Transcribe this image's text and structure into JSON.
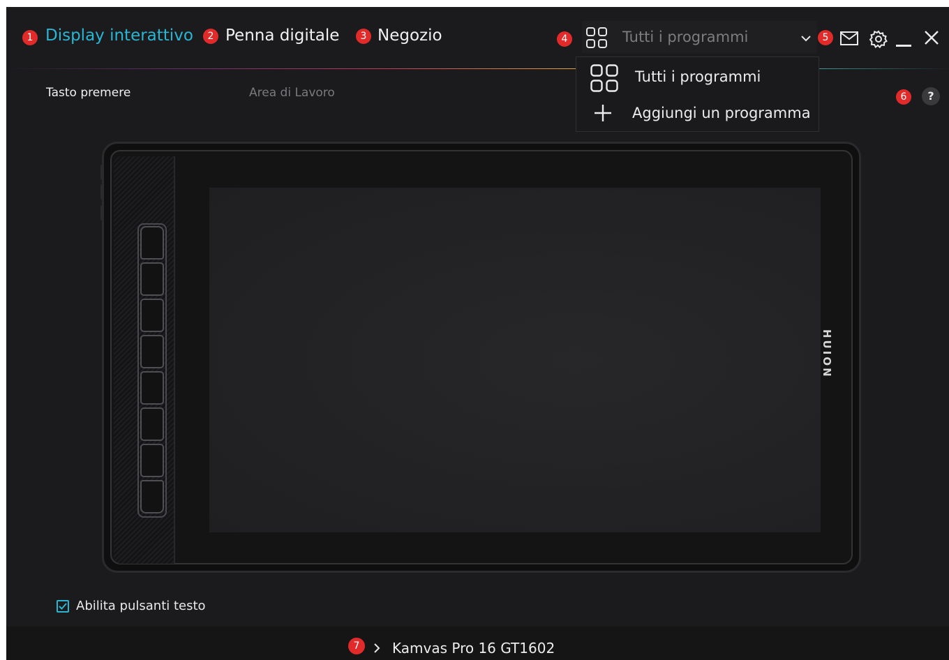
{
  "colors": {
    "background": "#1b1b1d",
    "accent": "#2ab6d3",
    "badge": "#e12b2b",
    "text": "#f1f1f1",
    "muted_text": "#7d7d80"
  },
  "badges": [
    "1",
    "2",
    "3",
    "4",
    "5",
    "6",
    "7"
  ],
  "nav": {
    "tabs": [
      {
        "label": "Display interattivo",
        "active": true
      },
      {
        "label": "Penna digitale",
        "active": false
      },
      {
        "label": "Negozio",
        "active": false
      }
    ]
  },
  "program_selector": {
    "icon": "grid-icon",
    "value": "Tutti i programmi",
    "options": [
      {
        "label": "Tutti i programmi",
        "icon": "grid-icon"
      },
      {
        "label": "Aggiungi un programma",
        "icon": "plus-icon"
      }
    ]
  },
  "window_controls": [
    "mail-icon",
    "gear-icon",
    "minimize-icon",
    "close-icon"
  ],
  "subtabs": [
    {
      "label": "Tasto premere",
      "active": true
    },
    {
      "label": "Area di Lavoro",
      "active": false
    }
  ],
  "help": {
    "label": "?"
  },
  "tablet": {
    "brand": "HUION",
    "express_keys": 8
  },
  "checkbox": {
    "label": "Abilita pulsanti testo",
    "checked": true
  },
  "footer": {
    "device": "Kamvas Pro 16 GT1602",
    "icon": "chevron-right-icon"
  }
}
